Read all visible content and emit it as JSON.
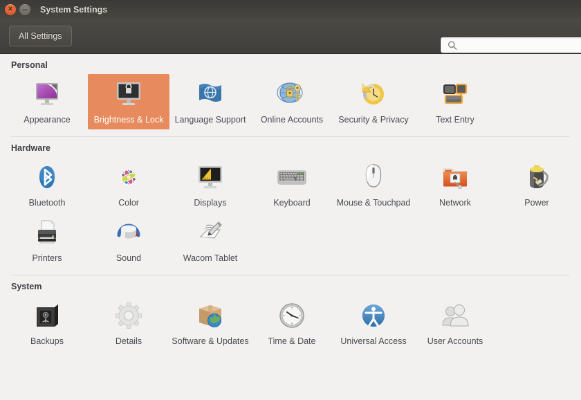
{
  "window": {
    "title": "System Settings",
    "close_glyph": "×",
    "minimize_glyph": "–"
  },
  "toolbar": {
    "all_settings_label": "All Settings",
    "search_placeholder": "",
    "search_value": "",
    "search_icon": "search-icon"
  },
  "sections": [
    {
      "id": "personal",
      "title": "Personal",
      "items": [
        {
          "label": "Appearance",
          "icon": "appearance-icon",
          "selected": false
        },
        {
          "label": "Brightness & Lock",
          "icon": "brightness-lock-icon",
          "selected": true
        },
        {
          "label": "Language Support",
          "icon": "language-support-icon",
          "selected": false
        },
        {
          "label": "Online Accounts",
          "icon": "online-accounts-icon",
          "selected": false
        },
        {
          "label": "Security & Privacy",
          "icon": "security-privacy-icon",
          "selected": false
        },
        {
          "label": "Text Entry",
          "icon": "text-entry-icon",
          "selected": false
        }
      ]
    },
    {
      "id": "hardware",
      "title": "Hardware",
      "items": [
        {
          "label": "Bluetooth",
          "icon": "bluetooth-icon",
          "selected": false
        },
        {
          "label": "Color",
          "icon": "color-icon",
          "selected": false
        },
        {
          "label": "Displays",
          "icon": "displays-icon",
          "selected": false
        },
        {
          "label": "Keyboard",
          "icon": "keyboard-icon",
          "selected": false
        },
        {
          "label": "Mouse & Touchpad",
          "icon": "mouse-touchpad-icon",
          "selected": false
        },
        {
          "label": "Network",
          "icon": "network-icon",
          "selected": false
        },
        {
          "label": "Power",
          "icon": "power-icon",
          "selected": false
        },
        {
          "label": "Printers",
          "icon": "printers-icon",
          "selected": false
        },
        {
          "label": "Sound",
          "icon": "sound-icon",
          "selected": false
        },
        {
          "label": "Wacom Tablet",
          "icon": "wacom-tablet-icon",
          "selected": false
        }
      ]
    },
    {
      "id": "system",
      "title": "System",
      "items": [
        {
          "label": "Backups",
          "icon": "backups-icon",
          "selected": false
        },
        {
          "label": "Details",
          "icon": "details-icon",
          "selected": false
        },
        {
          "label": "Software & Updates",
          "icon": "software-updates-icon",
          "selected": false
        },
        {
          "label": "Time & Date",
          "icon": "time-date-icon",
          "selected": false
        },
        {
          "label": "Universal Access",
          "icon": "universal-access-icon",
          "selected": false
        },
        {
          "label": "User Accounts",
          "icon": "user-accounts-icon",
          "selected": false
        }
      ]
    }
  ],
  "colors": {
    "selection": "#e78a5d",
    "background": "#f2f1f0",
    "titlebar": "#413f3b",
    "label_text": "#4b4b53"
  }
}
